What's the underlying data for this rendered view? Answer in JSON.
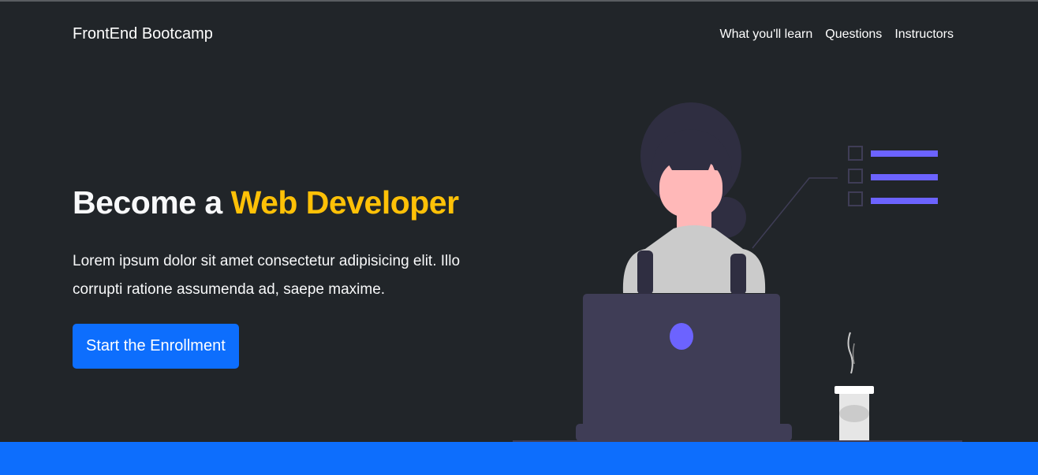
{
  "navbar": {
    "brand": "FrontEnd Bootcamp",
    "links": [
      {
        "label": "What you'll learn"
      },
      {
        "label": "Questions"
      },
      {
        "label": "Instructors"
      }
    ]
  },
  "hero": {
    "title_prefix": "Become a ",
    "title_accent": "Web Developer",
    "lead": "Lorem ipsum dolor sit amet consectetur adipisicing elit. Illo corrupti ratione assumenda ad, saepe maxime.",
    "cta_label": "Start the Enrollment"
  },
  "colors": {
    "background": "#212529",
    "accent": "#ffc107",
    "primary": "#0d6efd",
    "illustration_purple": "#6c63ff",
    "laptop": "#3f3d56"
  },
  "icons": {
    "illustration": "woman-at-laptop-illustration",
    "checklist": "checklist-icon",
    "coffee": "coffee-cup-icon"
  }
}
